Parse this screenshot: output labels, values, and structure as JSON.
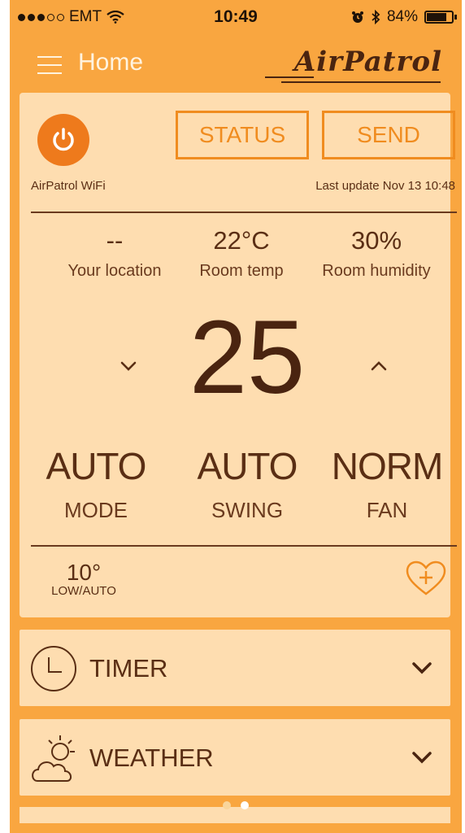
{
  "status_bar": {
    "carrier": "EMT",
    "time": "10:49",
    "battery": "84%",
    "battery_level": 0.84
  },
  "nav": {
    "title": "Home",
    "logo": "AirPatrol"
  },
  "device": {
    "name": "AirPatrol WiFi",
    "last_update": "Last update Nov 13 10:48",
    "status_label": "STATUS",
    "send_label": "SEND"
  },
  "stats": [
    {
      "value": "--",
      "label": "Your location"
    },
    {
      "value": "22°C",
      "label": "Room temp"
    },
    {
      "value": "30%",
      "label": "Room humidity"
    }
  ],
  "target_temp": "25",
  "settings": [
    {
      "value": "AUTO",
      "label": "MODE"
    },
    {
      "value": "AUTO",
      "label": "SWING"
    },
    {
      "value": "NORM",
      "label": "FAN"
    }
  ],
  "low": {
    "value": "10°",
    "label": "LOW/AUTO"
  },
  "sections": {
    "timer": "TIMER",
    "weather": "WEATHER"
  },
  "pager": {
    "count": 2,
    "active": 1
  },
  "colors": {
    "background": "#F9A640",
    "panel": "#FEDDB0",
    "accent": "#F08C1F",
    "power": "#EE7A1C",
    "text": "#5A2E14"
  },
  "icons": [
    "power-icon",
    "menu-icon",
    "chevron-down-icon",
    "chevron-up-icon",
    "heart-plus-icon",
    "clock-icon",
    "sun-cloud-icon",
    "wifi-icon",
    "alarm-icon",
    "bluetooth-icon",
    "battery-icon"
  ]
}
